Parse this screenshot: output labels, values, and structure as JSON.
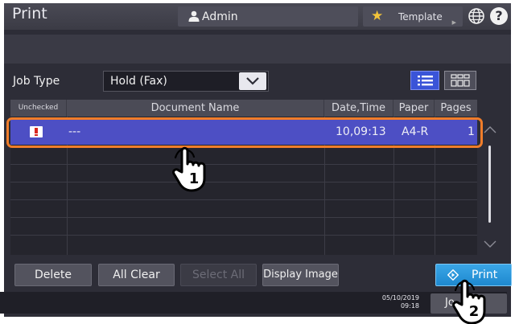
{
  "header": {
    "title": "Print",
    "user": "Admin",
    "template": "Template",
    "help": "?"
  },
  "filter": {
    "label": "Job Type",
    "value": "Hold (Fax)"
  },
  "table": {
    "columns": [
      "Unchecked",
      "Document Name",
      "Date,Time",
      "Paper",
      "Pages"
    ],
    "rows": [
      {
        "name": "---",
        "datetime": "10,09:13",
        "paper": "A4-R",
        "pages": "1"
      }
    ]
  },
  "buttons": {
    "delete": "Delete",
    "all_clear": "All Clear",
    "select_all": "Select All",
    "display_image": "Display Image",
    "print": "Print"
  },
  "footer": {
    "date": "05/10/2019",
    "time": "09:18",
    "job_button": "Jo"
  },
  "callouts": {
    "step1": "1",
    "step2": "2"
  },
  "colors": {
    "accent": "#f07d2a",
    "selected_row": "#4d4fc4",
    "print_button": "#2a96dc"
  }
}
